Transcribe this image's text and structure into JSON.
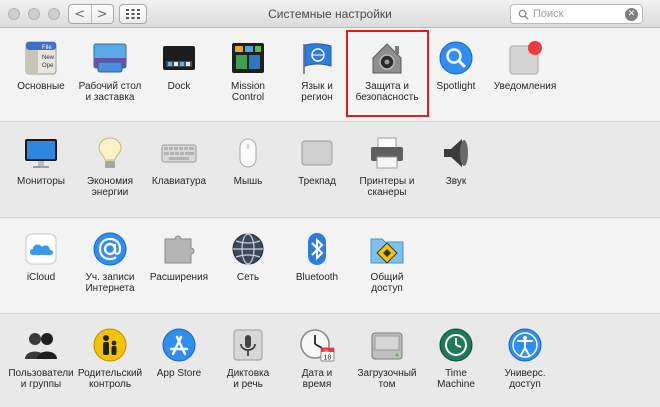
{
  "window": {
    "title": "Системные настройки",
    "back_glyph": "<",
    "forward_glyph": ">",
    "search_placeholder": "Поиск",
    "clear_glyph": "✕"
  },
  "sections": [
    {
      "panes": [
        {
          "label": "Основные",
          "icon": "general-icon"
        },
        {
          "label": "Рабочий стол\nи заставка",
          "icon": "desktop-icon"
        },
        {
          "label": "Dock",
          "icon": "dock-icon"
        },
        {
          "label": "Mission\nControl",
          "icon": "mission-control-icon"
        },
        {
          "label": "Язык и\nрегион",
          "icon": "language-icon"
        },
        {
          "label": "Защита и\nбезопасность",
          "icon": "security-icon",
          "highlighted": true
        },
        {
          "label": "Spotlight",
          "icon": "spotlight-icon"
        },
        {
          "label": "Уведомления",
          "icon": "notifications-icon"
        }
      ]
    },
    {
      "panes": [
        {
          "label": "Мониторы",
          "icon": "display-icon"
        },
        {
          "label": "Экономия\nэнергии",
          "icon": "energy-icon"
        },
        {
          "label": "Клавиатура",
          "icon": "keyboard-icon"
        },
        {
          "label": "Мышь",
          "icon": "mouse-icon"
        },
        {
          "label": "Трекпад",
          "icon": "trackpad-icon"
        },
        {
          "label": "Принтеры и\nсканеры",
          "icon": "printer-icon"
        },
        {
          "label": "Звук",
          "icon": "sound-icon"
        }
      ]
    },
    {
      "panes": [
        {
          "label": "iCloud",
          "icon": "icloud-icon"
        },
        {
          "label": "Уч. записи\nИнтернета",
          "icon": "internet-accounts-icon"
        },
        {
          "label": "Расширения",
          "icon": "extensions-icon"
        },
        {
          "label": "Сеть",
          "icon": "network-icon"
        },
        {
          "label": "Bluetooth",
          "icon": "bluetooth-icon"
        },
        {
          "label": "Общий\nдоступ",
          "icon": "sharing-icon"
        }
      ]
    },
    {
      "panes": [
        {
          "label": "Пользователи\nи группы",
          "icon": "users-icon"
        },
        {
          "label": "Родительский\nконтроль",
          "icon": "parental-controls-icon"
        },
        {
          "label": "App Store",
          "icon": "app-store-icon"
        },
        {
          "label": "Диктовка\nи речь",
          "icon": "dictation-icon"
        },
        {
          "label": "Дата и\nвремя",
          "icon": "date-time-icon"
        },
        {
          "label": "Загрузочный\nтом",
          "icon": "startup-disk-icon"
        },
        {
          "label": "Time\nMachine",
          "icon": "time-machine-icon"
        },
        {
          "label": "Универс.\nдоступ",
          "icon": "accessibility-icon"
        }
      ]
    }
  ],
  "icon_texts": {
    "general_file": "File",
    "general_new": "New",
    "general_open": "Ope",
    "calendar_day": "18",
    "calendar_month": "JUL"
  },
  "colors": {
    "highlight": "#e41b1b",
    "accent_blue": "#2f8ef0"
  }
}
